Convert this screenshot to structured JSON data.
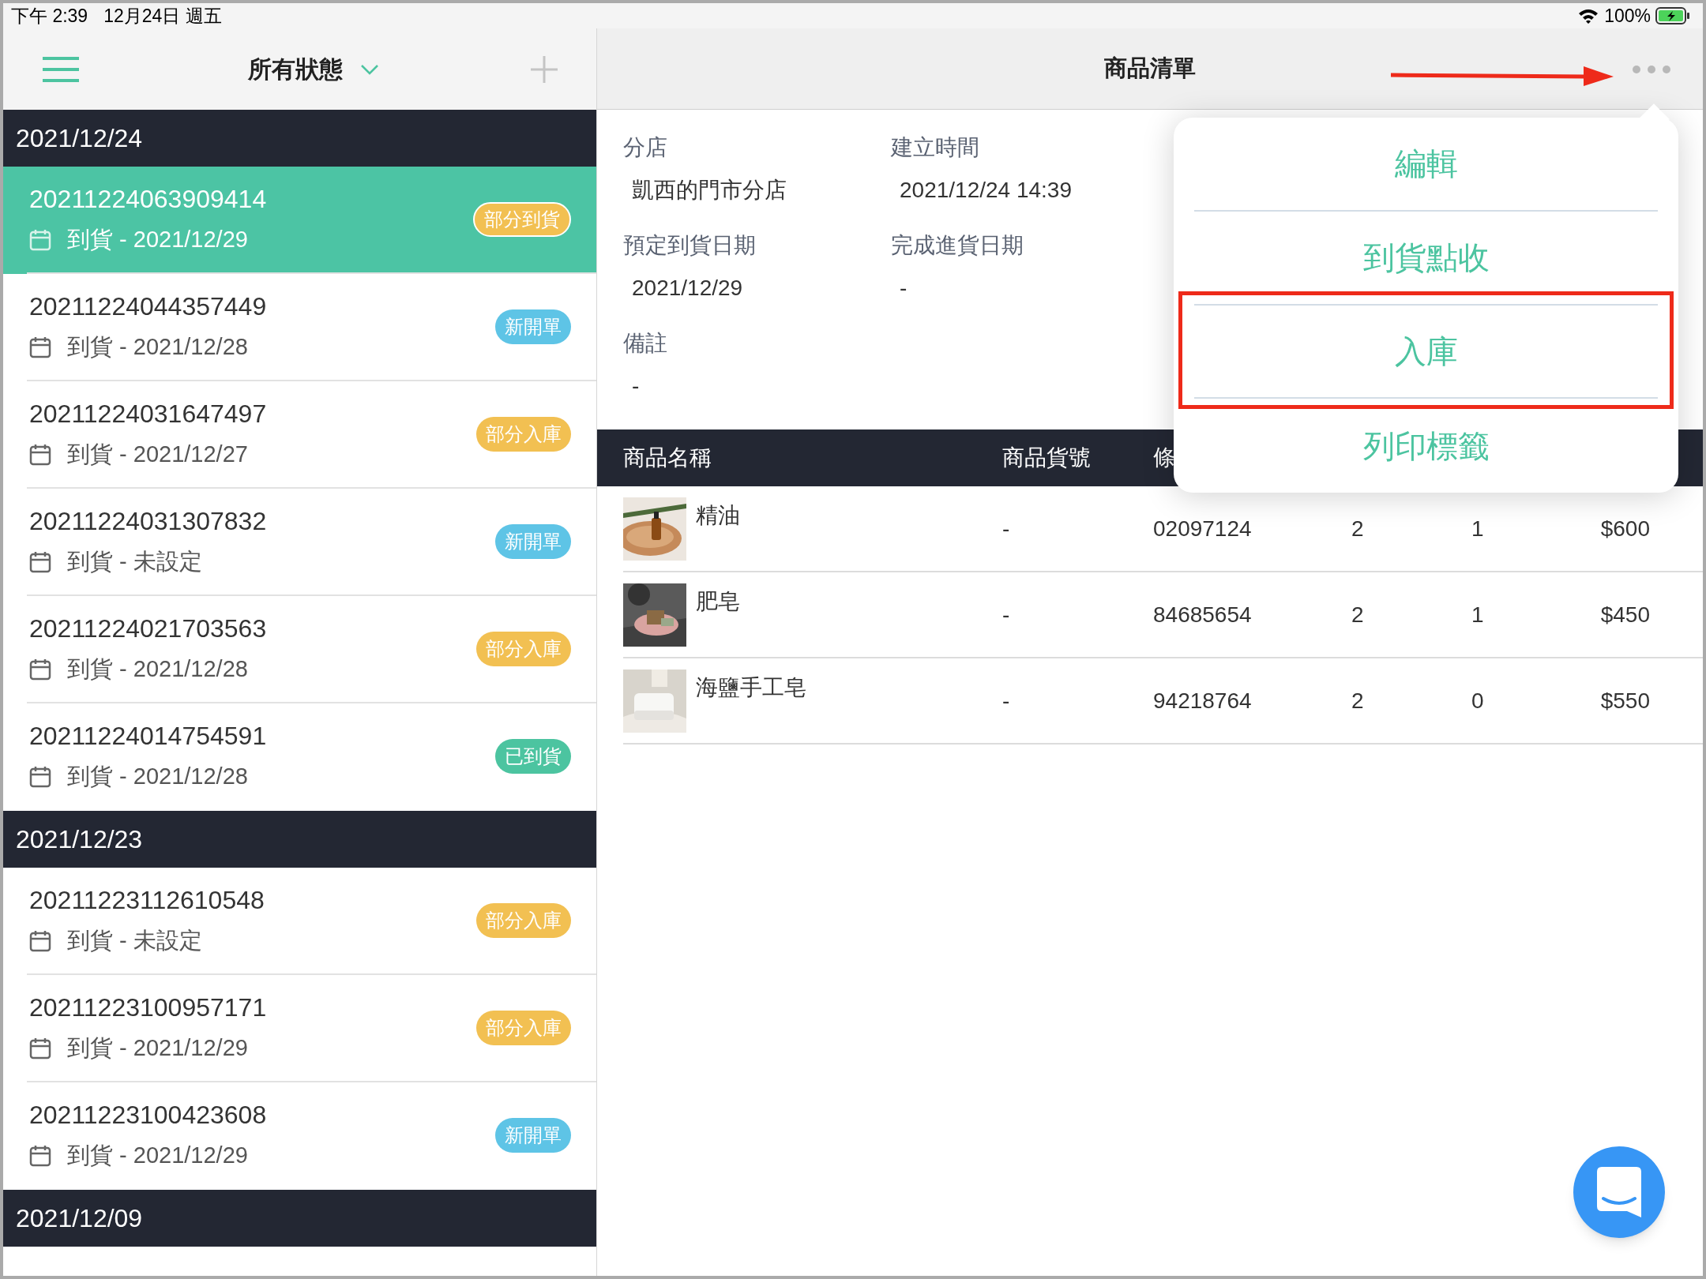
{
  "status_bar": {
    "time": "下午 2:39",
    "date": "12月24日 週五",
    "battery": "100%"
  },
  "left_nav": {
    "filter": "所有狀態"
  },
  "order_groups": [
    {
      "date": "2021/12/24",
      "orders": [
        {
          "number": "20211224063909414",
          "arrival": "到貨 - 2021/12/29",
          "status": "部分到貨",
          "color": "#f2c052",
          "selected": true
        },
        {
          "number": "20211224044357449",
          "arrival": "到貨 - 2021/12/28",
          "status": "新開單",
          "color": "#5ec4e6",
          "selected": false
        },
        {
          "number": "20211224031647497",
          "arrival": "到貨 - 2021/12/27",
          "status": "部分入庫",
          "color": "#f2c052",
          "selected": false
        },
        {
          "number": "20211224031307832",
          "arrival": "到貨 - 未設定",
          "status": "新開單",
          "color": "#5ec4e6",
          "selected": false
        },
        {
          "number": "20211224021703563",
          "arrival": "到貨 - 2021/12/28",
          "status": "部分入庫",
          "color": "#f2c052",
          "selected": false
        },
        {
          "number": "20211224014754591",
          "arrival": "到貨 - 2021/12/28",
          "status": "已到貨",
          "color": "#4cc4a0",
          "selected": false
        }
      ]
    },
    {
      "date": "2021/12/23",
      "orders": [
        {
          "number": "20211223112610548",
          "arrival": "到貨 - 未設定",
          "status": "部分入庫",
          "color": "#f2c052",
          "selected": false
        },
        {
          "number": "20211223100957171",
          "arrival": "到貨 - 2021/12/29",
          "status": "部分入庫",
          "color": "#f2c052",
          "selected": false
        },
        {
          "number": "20211223100423608",
          "arrival": "到貨 - 2021/12/29",
          "status": "新開單",
          "color": "#5ec4e6",
          "selected": false
        }
      ]
    },
    {
      "date": "2021/12/09"
    }
  ],
  "detail": {
    "title": "商品清單",
    "fields": [
      {
        "label": "分店",
        "value": "凱西的門市分店"
      },
      {
        "label": "建立時間",
        "value": "2021/12/24 14:39"
      },
      {
        "label": "預定到貨日期",
        "value": "2021/12/29"
      },
      {
        "label": "完成進貨日期",
        "value": "-"
      },
      {
        "label": "備註",
        "value": "-"
      }
    ]
  },
  "table": {
    "columns": [
      "商品名稱",
      "商品貨號",
      "條"
    ],
    "rows": [
      {
        "name": "精油",
        "sku": "-",
        "barcode": "02097124",
        "column_4": "2",
        "column_5": "1",
        "price": "$600"
      },
      {
        "name": "肥皂",
        "sku": "-",
        "barcode": "84685654",
        "column_4": "2",
        "column_5": "1",
        "price": "$450"
      },
      {
        "name": "海鹽手工皂",
        "sku": "-",
        "barcode": "94218764",
        "column_4": "2",
        "column_5": "0",
        "price": "$550"
      }
    ]
  },
  "menu": {
    "items": [
      {
        "label": "編輯",
        "annotated": false
      },
      {
        "label": "到貨點收",
        "annotated": false
      },
      {
        "label": "入庫",
        "annotated": true
      },
      {
        "label": "列印標籤",
        "annotated": false
      }
    ]
  }
}
